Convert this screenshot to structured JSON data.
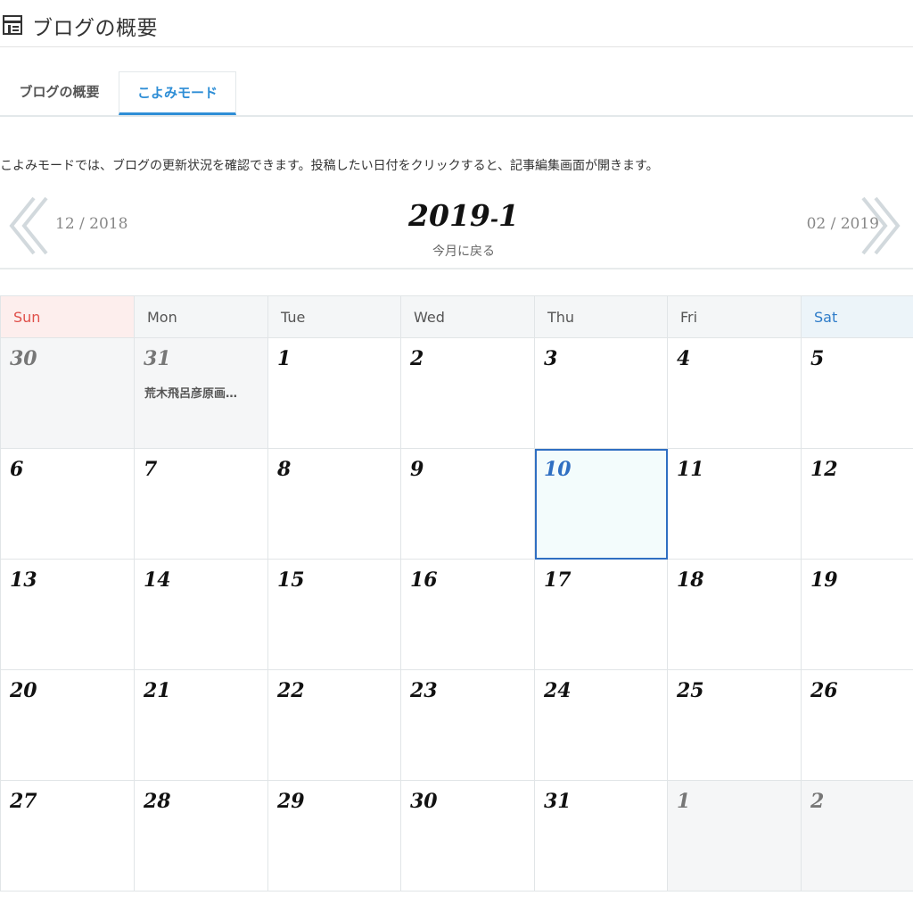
{
  "header": {
    "title": "ブログの概要",
    "icon": "dashboard-layout-icon"
  },
  "tabs": [
    {
      "label": "ブログの概要",
      "active": false
    },
    {
      "label": "こよみモード",
      "active": true
    }
  ],
  "description": "こよみモードでは、ブログの更新状況を確認できます。投稿したい日付をクリックすると、記事編集画面が開きます。",
  "month_nav": {
    "prev_label": "12 / 2018",
    "next_label": "02 / 2019",
    "current_year": "2019",
    "current_sep": "-",
    "current_month": "1",
    "back_today": "今月に戻る"
  },
  "weekdays": [
    "Sun",
    "Mon",
    "Tue",
    "Wed",
    "Thu",
    "Fri",
    "Sat"
  ],
  "weeks": [
    [
      {
        "day": "30",
        "other": true
      },
      {
        "day": "31",
        "other": true,
        "entry": "荒木飛呂彦原画…"
      },
      {
        "day": "1"
      },
      {
        "day": "2"
      },
      {
        "day": "3"
      },
      {
        "day": "4"
      },
      {
        "day": "5"
      }
    ],
    [
      {
        "day": "6"
      },
      {
        "day": "7"
      },
      {
        "day": "8"
      },
      {
        "day": "9"
      },
      {
        "day": "10",
        "today": true
      },
      {
        "day": "11"
      },
      {
        "day": "12"
      }
    ],
    [
      {
        "day": "13"
      },
      {
        "day": "14"
      },
      {
        "day": "15"
      },
      {
        "day": "16"
      },
      {
        "day": "17"
      },
      {
        "day": "18"
      },
      {
        "day": "19"
      }
    ],
    [
      {
        "day": "20"
      },
      {
        "day": "21"
      },
      {
        "day": "22"
      },
      {
        "day": "23"
      },
      {
        "day": "24"
      },
      {
        "day": "25"
      },
      {
        "day": "26"
      }
    ],
    [
      {
        "day": "27"
      },
      {
        "day": "28"
      },
      {
        "day": "29"
      },
      {
        "day": "30"
      },
      {
        "day": "31"
      },
      {
        "day": "1",
        "other": true
      },
      {
        "day": "2",
        "other": true
      }
    ]
  ],
  "colors": {
    "accent": "#2e8ed6",
    "sunday": "#e0504a",
    "saturday": "#2e7cc9",
    "today_border": "#2f6fc2"
  }
}
